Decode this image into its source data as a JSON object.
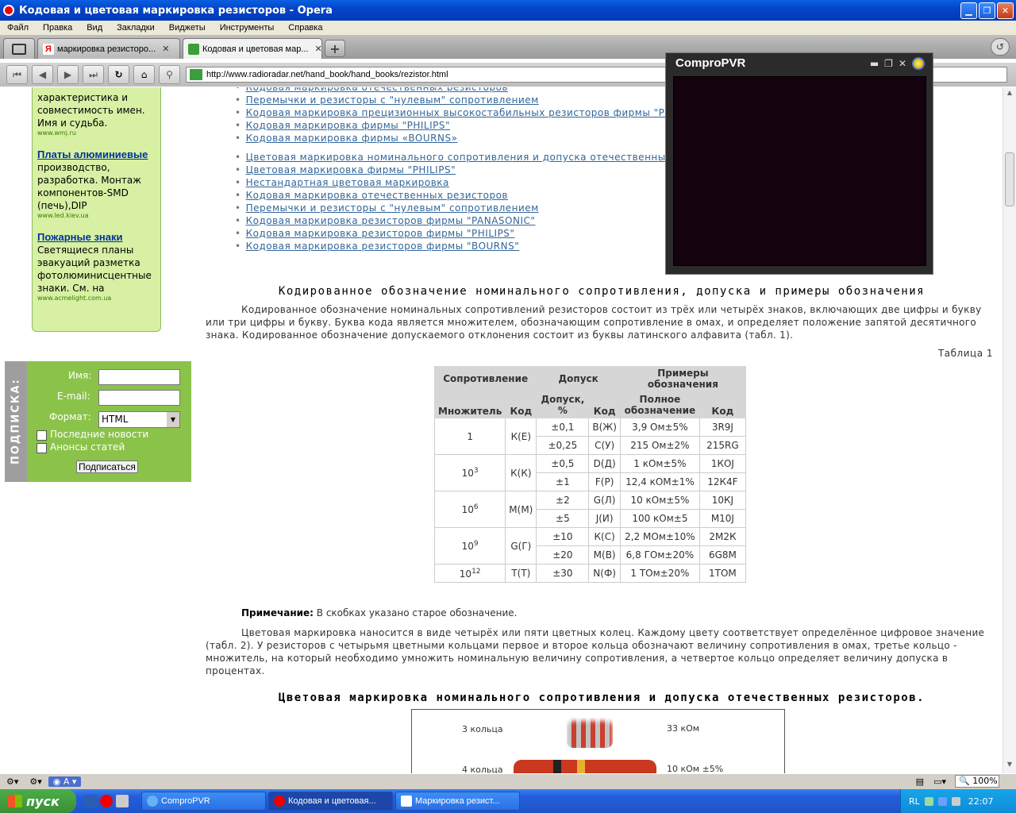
{
  "window": {
    "title": "Кодовая и цветовая маркировка резисторов - Opera"
  },
  "menu": [
    "Файл",
    "Правка",
    "Вид",
    "Закладки",
    "Виджеты",
    "Инструменты",
    "Справка"
  ],
  "tabs": [
    {
      "label": "маркировка резисторо...",
      "active": false
    },
    {
      "label": "Кодовая и цветовая мар...",
      "active": true
    }
  ],
  "address": {
    "url": "http://www.radioradar.net/hand_book/hand_books/rezistor.html"
  },
  "ads": [
    {
      "text_top": "характеристика и совместимость имен. Имя и судьба.",
      "url": "www.wmj.ru"
    },
    {
      "title": "Платы алюминиевые",
      "text": "производство, разработка. Монтаж компонентов-SMD (печь),DIP",
      "url": "www.led.kiev.ua"
    },
    {
      "title": "Пожарные знаки",
      "text": "Светящиеся планы эвакуаций разметка фотолюминисцентные знаки. См. на",
      "url": "www.acmelight.com.ua"
    }
  ],
  "subscribe": {
    "side_label": "ПОДПИСКА:",
    "name_label": "Имя:",
    "email_label": "E-mail:",
    "format_label": "Формат:",
    "format_value": "HTML",
    "check1": "Последние новости",
    "check2": "Анонсы статей",
    "button": "Подписаться"
  },
  "links_group1": [
    "Кодовая маркировка отечественных резисторов",
    "Перемычки и резисторы с \"нулевым\" сопротивлением",
    "Кодовая маркировка прецизионных высокостабильных резисторов фирмы \"PHILIPS\"",
    "Кодовая маркировка фирмы \"PHILIPS\"",
    "Кодовая маркировка фирмы «BOURNS»"
  ],
  "links_group2": [
    "Цветовая маркировка номинального сопротивления и допуска отечественных резисторов",
    "Цветовая маркировка фирмы \"PHILIPS\"",
    "Нестандартная цветовая маркировка",
    "Кодовая маркировка отечественных резисторов",
    "Перемычки и резисторы с \"нулевым\" сопротивлением",
    "Кодовая маркировка резисторов фирмы \"PANASONIC\"",
    "Кодовая маркировка резисторов фирмы \"PHILIPS\"",
    "Кодовая маркировка резисторов фирмы \"BOURNS\""
  ],
  "section1": {
    "heading": "Кодированное обозначение номинального сопротивления, допуска и примеры обозначения",
    "text": "Кодированное обозначение номинальных сопротивлений резисторов состоит из трёх или четырёх знаков, включающих две цифры и букву или три цифры и букву. Буква кода является множителем, обозначающим сопротивление в омах, и определяет положение запятой десятичного знака. Кодированное обозначение допускаемого отклонения состоит из буквы латинского алфавита (табл. 1).",
    "table_label": "Таблица 1"
  },
  "table": {
    "group_headers": [
      "Сопротивление",
      "Допуск",
      "Примеры обозначения"
    ],
    "headers": [
      "Множитель",
      "Код",
      "Допуск, %",
      "Код",
      "Полное обозначение",
      "Код"
    ],
    "groups": [
      {
        "mult_base": "1",
        "mult_exp": "",
        "code": "К(Е)",
        "rows": [
          [
            "±0,1",
            "В(Ж)",
            "3,9 Ом±5%",
            "3R9J"
          ],
          [
            "±0,25",
            "С(У)",
            "215 Ом±2%",
            "215RG"
          ]
        ]
      },
      {
        "mult_base": "10",
        "mult_exp": "3",
        "code": "К(К)",
        "rows": [
          [
            "±0,5",
            "D(Д)",
            "1 кОм±5%",
            "1КОJ"
          ],
          [
            "±1",
            "F(Р)",
            "12,4 кОМ±1%",
            "12К4F"
          ]
        ]
      },
      {
        "mult_base": "10",
        "mult_exp": "6",
        "code": "М(М)",
        "rows": [
          [
            "±2",
            "G(Л)",
            "10 кОм±5%",
            "10КJ"
          ],
          [
            "±5",
            "J(И)",
            "100 кОм±5",
            "М10J"
          ]
        ]
      },
      {
        "mult_base": "10",
        "mult_exp": "9",
        "code": "G(Г)",
        "rows": [
          [
            "±10",
            "К(С)",
            "2,2 МОм±10%",
            "2М2К"
          ],
          [
            "±20",
            "М(В)",
            "6,8 ГОм±20%",
            "6G8M"
          ]
        ]
      },
      {
        "mult_base": "10",
        "mult_exp": "12",
        "code": "Т(Т)",
        "rows": [
          [
            "±30",
            "N(Ф)",
            "1 ТОм±20%",
            "1ТОМ"
          ]
        ]
      }
    ]
  },
  "note": {
    "label": "Примечание:",
    "text": " В скобках указано старое обозначение."
  },
  "section2": {
    "text": "Цветовая маркировка наносится в виде четырёх или пяти цветных колец. Каждому цвету соответствует определённое цифровое значение (табл. 2). У резисторов с четырьмя цветными кольцами первое и второе кольца обозначают величину сопротивления в омах, третье кольцо - множитель, на который необходимо умножить номинальную величину сопротивления, а четвертое кольцо определяет величину допуска в процентах.",
    "heading": "Цветовая маркировка номинального сопротивления и допуска отечественных резисторов."
  },
  "figure": {
    "row1_label": "3 кольца",
    "row1_value": "33 кОм",
    "row2_label": "4 кольца",
    "row2_value": "10 кОм ±5%"
  },
  "compro": {
    "title": "ComproPVR"
  },
  "statusbar": {
    "zoom": "100%"
  },
  "taskbar": {
    "start": "пуск",
    "items": [
      "ComproPVR",
      "Кодовая и цветовая...",
      "Маркировка резист..."
    ],
    "lang": "RL",
    "clock": "22:07"
  }
}
